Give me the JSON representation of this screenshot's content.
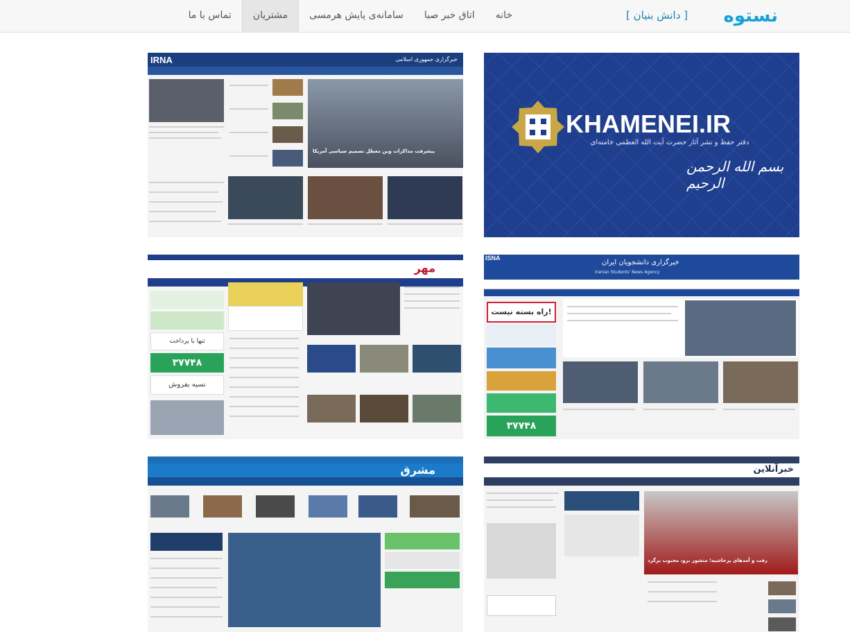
{
  "header": {
    "logo_text": "نستوه",
    "logo_sub": "[ دانش بنیان ]",
    "nav": [
      "خانه",
      "اتاق خبر صبا",
      "سامانه‌ی پایش هرمسی",
      "مشتریان",
      "تماس با ما"
    ],
    "active_nav": "مشتریان"
  },
  "customers": [
    {
      "name": "khamenei",
      "title": "KHAMENEI.IR",
      "subtitle": "دفتر حفظ و نشر آثار حضرت آیت الله العظمی خامنه‌ای",
      "motto": "بسم الله الرحمن الرحیم"
    },
    {
      "name": "irna",
      "title": "IRNA",
      "site_title": "خبرگزاری جمهوری اسلامی",
      "headline": "پیشرفت مذاکرات وین معطل تصمیم سیاسی آمریکا"
    },
    {
      "name": "isna",
      "title": "ISNA",
      "site_title": "خبرگزاری دانشجویان ایران",
      "subtitle": "Iranian Students' News Agency",
      "banner": "راه بسته نیست!",
      "price": "۳۷۷۴۸"
    },
    {
      "name": "mehr",
      "title": "مهر",
      "banner": "تنها با پرداخت",
      "price": "۳۷۷۴۸",
      "ad": "نسیه بفروش"
    },
    {
      "name": "khabaronline",
      "title": "خبرآنلاین",
      "headline": "رفت و آمدهای پرحاشیه؛ منشور برو، محبوب برگرد"
    },
    {
      "name": "mashregh",
      "title": "مشرق"
    }
  ],
  "colors": {
    "accent": "#1aa0d8",
    "irna_blue": "#1b3f7e",
    "isna_blue": "#1f4a9c",
    "mehr_blue": "#1f3f8c",
    "mashregh_blue": "#1c6fb7",
    "khabaronline_navy": "#2f3e63",
    "khamenei_bg": "#1f3f8e"
  }
}
